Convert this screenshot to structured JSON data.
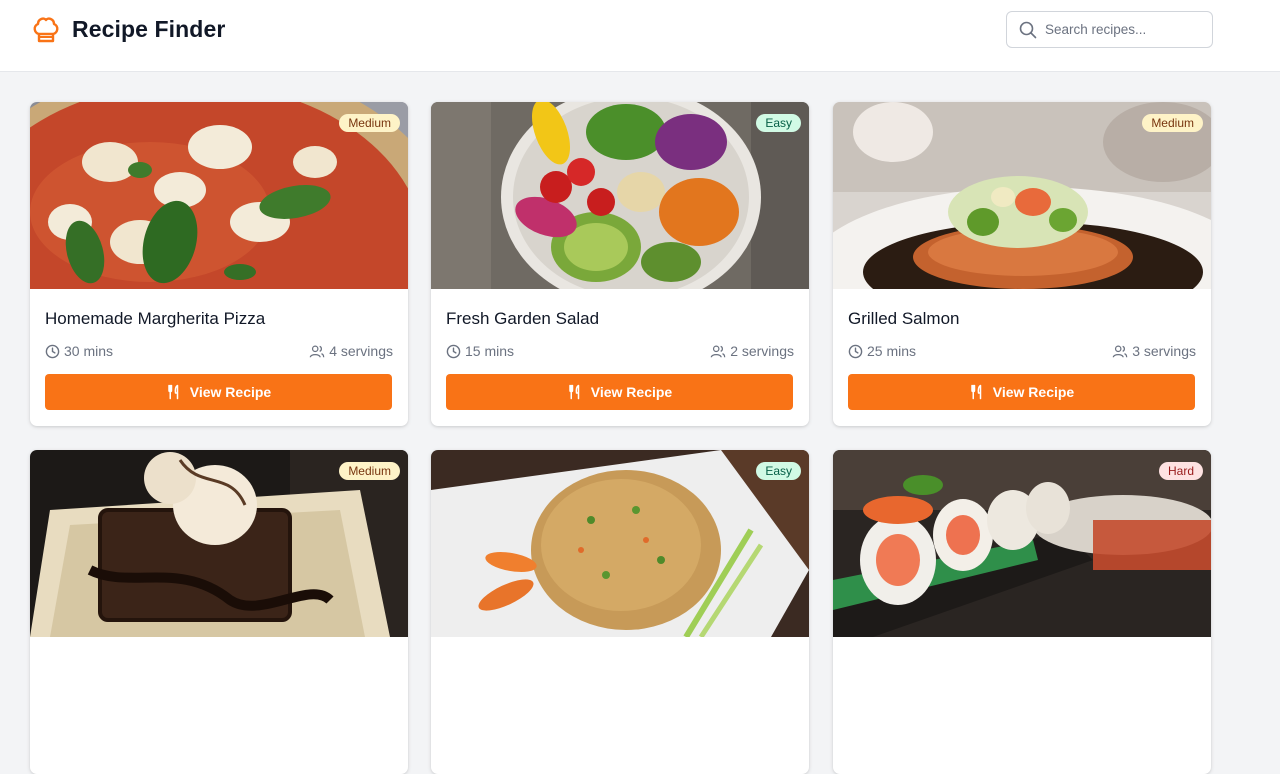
{
  "header": {
    "title": "Recipe Finder",
    "logo_icon": "chef-hat-icon",
    "search_placeholder": "Search recipes...",
    "search_value": ""
  },
  "colors": {
    "accent": "#f97316",
    "medium_badge": "#fef3c7",
    "easy_badge": "#d1fae5",
    "hard_badge": "#fee2e2"
  },
  "recipes": [
    {
      "title": "Homemade Margherita Pizza",
      "time": "30 mins",
      "servings": "4 servings",
      "difficulty": "Medium",
      "button": "View Recipe",
      "image": "pizza"
    },
    {
      "title": "Fresh Garden Salad",
      "time": "15 mins",
      "servings": "2 servings",
      "difficulty": "Easy",
      "button": "View Recipe",
      "image": "salad"
    },
    {
      "title": "Grilled Salmon",
      "time": "25 mins",
      "servings": "3 servings",
      "difficulty": "Medium",
      "button": "View Recipe",
      "image": "salmon"
    },
    {
      "title": "",
      "time": "",
      "servings": "",
      "difficulty": "Medium",
      "button": "",
      "image": "brownie"
    },
    {
      "title": "",
      "time": "",
      "servings": "",
      "difficulty": "Easy",
      "button": "",
      "image": "fried-rice"
    },
    {
      "title": "",
      "time": "",
      "servings": "",
      "difficulty": "Hard",
      "button": "",
      "image": "sushi"
    }
  ]
}
